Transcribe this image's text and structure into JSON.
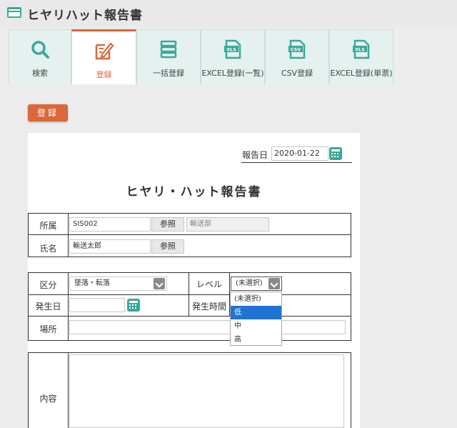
{
  "header": {
    "title": "ヒヤリハット報告書",
    "icon": "window-icon"
  },
  "tabs": [
    {
      "label": "検索",
      "icon": "search-icon"
    },
    {
      "label": "登録",
      "icon": "edit-icon",
      "active": true
    },
    {
      "label": "一括登録",
      "icon": "stack-icon"
    },
    {
      "label": "EXCEL登録(一覧)",
      "icon": "xls-file-icon",
      "badge": "XLS"
    },
    {
      "label": "CSV登録",
      "icon": "csv-file-icon",
      "badge": "CSV"
    },
    {
      "label": "EXCEL登録(単票)",
      "icon": "xls-file-icon",
      "badge": "XLS"
    }
  ],
  "actions": {
    "register_label": "登録"
  },
  "form": {
    "report_date_label": "報告日",
    "report_date_value": "2020-01-22",
    "title": "ヒヤリ・ハット報告書",
    "department_label": "所属",
    "department_code": "SIS002",
    "department_name": "輸送部",
    "reference_label": "参照",
    "name_label": "氏名",
    "name_value": "輸送太郎",
    "category_label": "区分",
    "category_value": "墜落・転落",
    "level_label": "レベル",
    "level_value": "(未選択)",
    "level_options": [
      "(未選択)",
      "低",
      "中",
      "高"
    ],
    "level_highlighted": "低",
    "occur_date_label": "発生日",
    "occur_time_label": "発生時間",
    "place_label": "場所",
    "content_label": "内容"
  },
  "colors": {
    "accent": "#d9683a",
    "teal": "#3aa89a",
    "selection": "#1e73d4"
  }
}
